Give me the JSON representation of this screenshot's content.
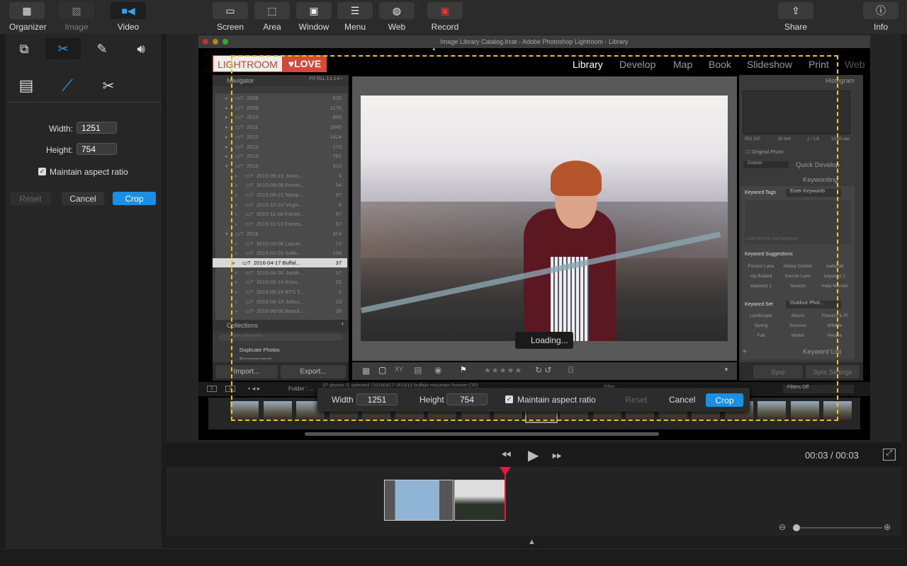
{
  "toolbar": {
    "left": [
      {
        "label": "Organizer",
        "icon": "grid-icon"
      },
      {
        "label": "Image",
        "icon": "image-icon"
      },
      {
        "label": "Video",
        "icon": "video-camera-icon"
      }
    ],
    "capture": [
      {
        "label": "Screen"
      },
      {
        "label": "Area"
      },
      {
        "label": "Window"
      },
      {
        "label": "Menu"
      },
      {
        "label": "Web"
      },
      {
        "label": "Record"
      }
    ],
    "share": "Share",
    "info": "Info"
  },
  "left_panel": {
    "width_label": "Width:",
    "width_value": "1251",
    "height_label": "Height:",
    "height_value": "754",
    "aspect_label": "Maintain aspect ratio",
    "aspect_checked": true,
    "reset": "Reset",
    "cancel": "Cancel",
    "crop": "Crop",
    "accent": "#1a8fe3"
  },
  "lightroom": {
    "title": "Image Library Catalog.lrcat - Adobe Photoshop Lightroom - Library",
    "logo_left": "LIGHTROOM",
    "logo_right": "♥LOVE",
    "modules": [
      "Library",
      "Develop",
      "Map",
      "Book",
      "Slideshow",
      "Print",
      "Web"
    ],
    "navigator": "Navigator",
    "nav_opts": "FIT  FILL  1:1  1:4 ÷",
    "folders": [
      {
        "name": "2008",
        "count": "525",
        "level": 0
      },
      {
        "name": "2009",
        "count": "1176",
        "level": 0
      },
      {
        "name": "2010",
        "count": "889",
        "level": 0
      },
      {
        "name": "2011",
        "count": "1845",
        "level": 0
      },
      {
        "name": "2012",
        "count": "1424",
        "level": 0
      },
      {
        "name": "2013",
        "count": "275",
        "level": 0
      },
      {
        "name": "2014",
        "count": "791",
        "level": 0
      },
      {
        "name": "2015",
        "count": "310",
        "level": 0
      },
      {
        "name": "2015-06-15 Jacks...",
        "count": "6",
        "level": 1
      },
      {
        "name": "2015-08-08 Forres...",
        "count": "54",
        "level": 1
      },
      {
        "name": "2015-09-21 Newp...",
        "count": "97",
        "level": 1
      },
      {
        "name": "2015-10-23 Virgin...",
        "count": "9",
        "level": 1
      },
      {
        "name": "2015-11-08 Forres...",
        "count": "87",
        "level": 1
      },
      {
        "name": "2015-11-13 Forres...",
        "count": "57",
        "level": 1
      },
      {
        "name": "2016",
        "count": "374",
        "level": 0
      },
      {
        "name": "2016-03-06 Laurel...",
        "count": "72",
        "level": 1
      },
      {
        "name": "2016-03-26 India...",
        "count": "159",
        "level": 1
      },
      {
        "name": "2016-04-17 Buffal...",
        "count": "37",
        "level": 1,
        "selected": true
      },
      {
        "name": "2016-04-30 Jacob...",
        "count": "17",
        "level": 1
      },
      {
        "name": "2016-05-19 Knox...",
        "count": "25",
        "level": 1
      },
      {
        "name": "2016-05-24 BTS T...",
        "count": "2",
        "level": 1
      },
      {
        "name": "2016-06-10 Johns...",
        "count": "23",
        "level": 1
      },
      {
        "name": "2016-08-06 Beaut...",
        "count": "39",
        "level": 1
      }
    ],
    "collections": "Collections",
    "collection_filter": "Filter Collections",
    "collection_items": [
      "Duplicate Photos",
      "Engagements"
    ],
    "import": "Import...",
    "export": "Export...",
    "loading": "Loading...",
    "histogram": "Histogram",
    "exif": [
      "ISO 320",
      "50 mm",
      "ƒ / 1.8",
      "1/160 sec"
    ],
    "original_photo": "Original Photo",
    "preset": "Custom",
    "quick_develop": "Quick Develop",
    "keywording": "Keywording",
    "keyword_tags": "Keyword Tags",
    "enter_keywords": "Enter Keywords",
    "add_keywords_placeholder": "Click here to add keywords",
    "keyword_suggestions": "Keyword Suggestions",
    "suggestions": [
      "Forrest Lane",
      "Abbey Golden",
      "waterfall",
      "Aly Bullard",
      "Kenzie Lane",
      "keyword 2",
      "keyword 1",
      "Seniors",
      "India Mcrook"
    ],
    "keyword_set": "Keyword Set",
    "keyword_set_value": "Outdoor Phot...",
    "set_words": [
      "Landscape",
      "Macro",
      "Flowers & Pl",
      "Spring",
      "Summer",
      "Wildlife",
      "Fall",
      "Winter",
      "People"
    ],
    "keyword_list": "Keyword List",
    "sync": "Sync",
    "sync_settings": "Sync Settings",
    "folder_label": "Folder : ...",
    "status": "37 photos /1 selected /20160417-201610 buffalo mountain forever.CR2",
    "filter": "Filter :",
    "filters_off": "Filters Off",
    "page1": "1",
    "page2": "2"
  },
  "crop_dialog": {
    "width_label": "Width",
    "width_value": "1251",
    "height_label": "Height",
    "height_value": "754",
    "aspect_label": "Maintain aspect ratio",
    "reset": "Reset",
    "cancel": "Cancel",
    "crop": "Crop"
  },
  "playback": {
    "time": "00:03 / 00:03"
  },
  "colors": {
    "crop_guide": "#e8c61a",
    "playhead": "#e8173f",
    "accent": "#1a8fe3"
  }
}
